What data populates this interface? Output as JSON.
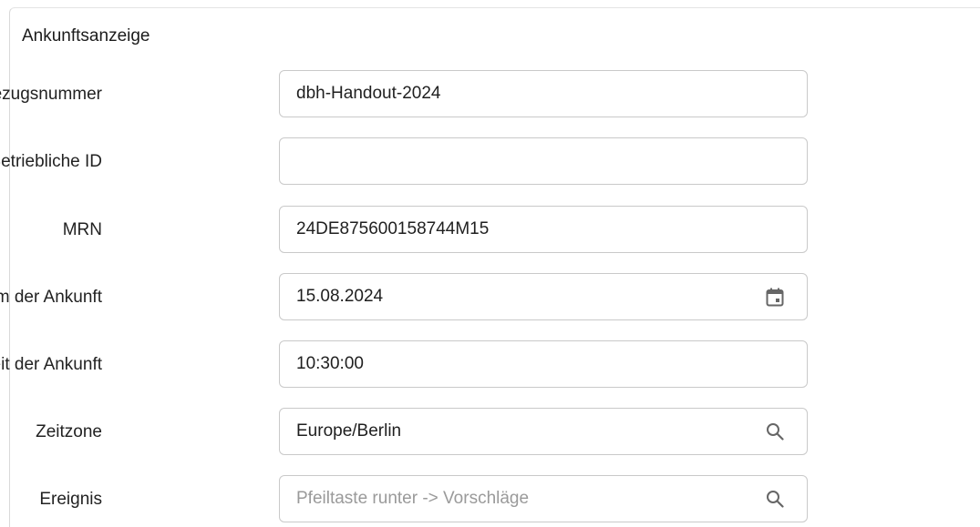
{
  "section": {
    "title": "Ankunftsanzeige"
  },
  "fields": [
    {
      "label": "Bezugsnummer",
      "value": "dbh-Handout-2024",
      "placeholder": ""
    },
    {
      "label": "Betriebliche ID",
      "value": "",
      "placeholder": ""
    },
    {
      "label": "MRN",
      "value": "24DE875600158744M15",
      "placeholder": ""
    },
    {
      "label": "Datum der Ankunft",
      "value": "15.08.2024",
      "placeholder": "",
      "icon": "calendar-icon"
    },
    {
      "label": "Zeit der Ankunft",
      "value": "10:30:00",
      "placeholder": ""
    },
    {
      "label": "Zeitzone",
      "value": "Europe/Berlin",
      "placeholder": "",
      "icon": "search-icon"
    },
    {
      "label": "Ereignis",
      "value": "",
      "placeholder": "Pfeiltaste runter -> Vorschläge",
      "icon": "search-icon"
    }
  ],
  "colors": {
    "border": "#c9c9c9",
    "icon": "#666666",
    "placeholder": "#9a9a9a"
  }
}
